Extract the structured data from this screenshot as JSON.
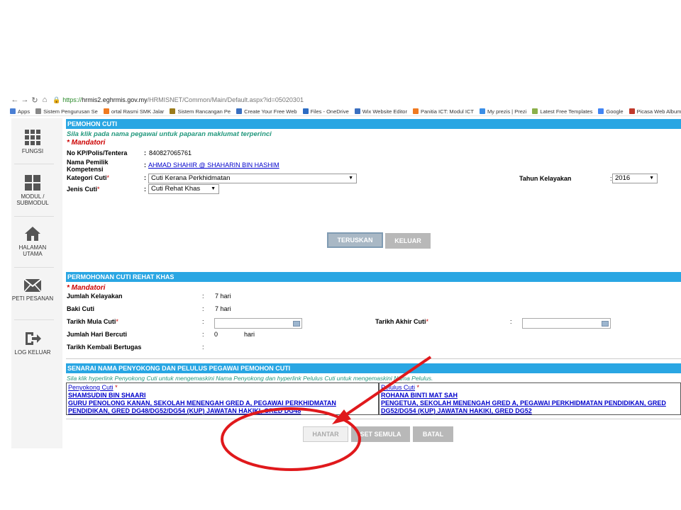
{
  "browser": {
    "url_secure": "https://",
    "url_host": "hrmis2.eghrmis.gov.my",
    "url_path": "/HRMISNET/Common/Main/Default.aspx?id=05020301",
    "bookmarks": [
      {
        "label": "Apps",
        "color": "#4a7fd4"
      },
      {
        "label": "Sistem Pengurusan Se",
        "color": "#888888"
      },
      {
        "label": "ortal Rasmi SMK Jalar",
        "color": "#f07a20"
      },
      {
        "label": "Sistem Rancangan Pe",
        "color": "#9a7b1a"
      },
      {
        "label": "Create Your Free Web",
        "color": "#3a6fc0"
      },
      {
        "label": "Files - OneDrive",
        "color": "#2b6cc4"
      },
      {
        "label": "Wix Website Editor",
        "color": "#3a6fc0"
      },
      {
        "label": "Panitia ICT: Modul ICT",
        "color": "#f07a20"
      },
      {
        "label": "My prezis | Prezi",
        "color": "#3a8ee6"
      },
      {
        "label": "Latest Free Templates",
        "color": "#8ab04a"
      },
      {
        "label": "Google",
        "color": "#4285f4"
      },
      {
        "label": "Picasa Web Albums",
        "color": "#c0392b"
      }
    ]
  },
  "sidebar": {
    "items": [
      {
        "label": "FUNGSI"
      },
      {
        "label": "MODUL / SUBMODUL"
      },
      {
        "label": "HALAMAN UTAMA"
      },
      {
        "label": "PETI PESANAN"
      },
      {
        "label": "LOG KELUAR"
      }
    ]
  },
  "pemohon": {
    "header": "PEMOHON CUTI",
    "hint": "Sila klik pada nama pegawai untuk paparan maklumat terperinci",
    "mandatori": "* Mandatori",
    "kp_label": "No KP/Polis/Tentera",
    "kp_value": "840827065761",
    "nama_label": "Nama Pemilik Kompetensi",
    "nama_value": "AHMAD SHAHIR @ SHAHARIN BIN HASHIM",
    "kategori_label": "Kategori Cuti",
    "kategori_value": "Cuti Kerana Perkhidmatan",
    "jenis_label": "Jenis Cuti",
    "jenis_value": "Cuti Rehat Khas",
    "tahun_label": "Tahun Kelayakan",
    "tahun_value": "2016",
    "colon": ":",
    "req_mark": "*",
    "teruskan": "TERUSKAN",
    "keluar": "KELUAR"
  },
  "permohonan": {
    "header": "PERMOHONAN CUTI REHAT KHAS",
    "mandatori": "* Mandatori",
    "jumlah_kelayakan_label": "Jumlah Kelayakan",
    "jumlah_kelayakan_value": "7 hari",
    "baki_label": "Baki Cuti",
    "baki_value": "7 hari",
    "mula_label": "Tarikh Mula Cuti",
    "akhir_label": "Tarikh Akhir Cuti",
    "hari_bercuti_label": "Jumlah Hari Bercuti",
    "hari_bercuti_value": "0",
    "hari_unit": "hari",
    "kembali_label": "Tarikh Kembali Bertugas"
  },
  "senarai": {
    "header": "SENARAI NAMA PENYOKONG DAN PELULUS PEGAWAI PEMOHON CUTI",
    "hint": "Sila klik hyperlink Penyokong Cuti untuk mengemaskini Nama Penyokong dan hyperlink Pelulus Cuti untuk mengemaskini Nama Pelulus.",
    "penyokong_title": "Penyokong Cuti",
    "penyokong_name": "SHAMSUDIN BIN SHAARI",
    "penyokong_line1": "GURU PENOLONG KANAN, SEKOLAH MENENGAH GRED A, PEGAWAI PERKHIDMATAN",
    "penyokong_line2": "PENDIDIKAN, GRED DG48/DG52/DG54 (KUP) JAWATAN HAKIKI, GRED DG48",
    "pelulus_title": "Pelulus Cuti",
    "pelulus_name": "ROHANA BINTI MAT SAH",
    "pelulus_line1": "PENGETUA, SEKOLAH MENENGAH GRED A, PEGAWAI PERKHIDMATAN PENDIDIKAN, GRED",
    "pelulus_line2": "DG52/DG54 (KUP) JAWATAN HAKIKI, GRED DG52",
    "hantar": "HANTAR",
    "set_semula": "SET SEMULA",
    "batal": "BATAL"
  },
  "colors": {
    "header_blue": "#29a6e3",
    "teal_hint": "#22987d",
    "mandatory_red": "#cc0000",
    "annotation_red": "#e0191c",
    "link_blue": "#0000cc"
  }
}
